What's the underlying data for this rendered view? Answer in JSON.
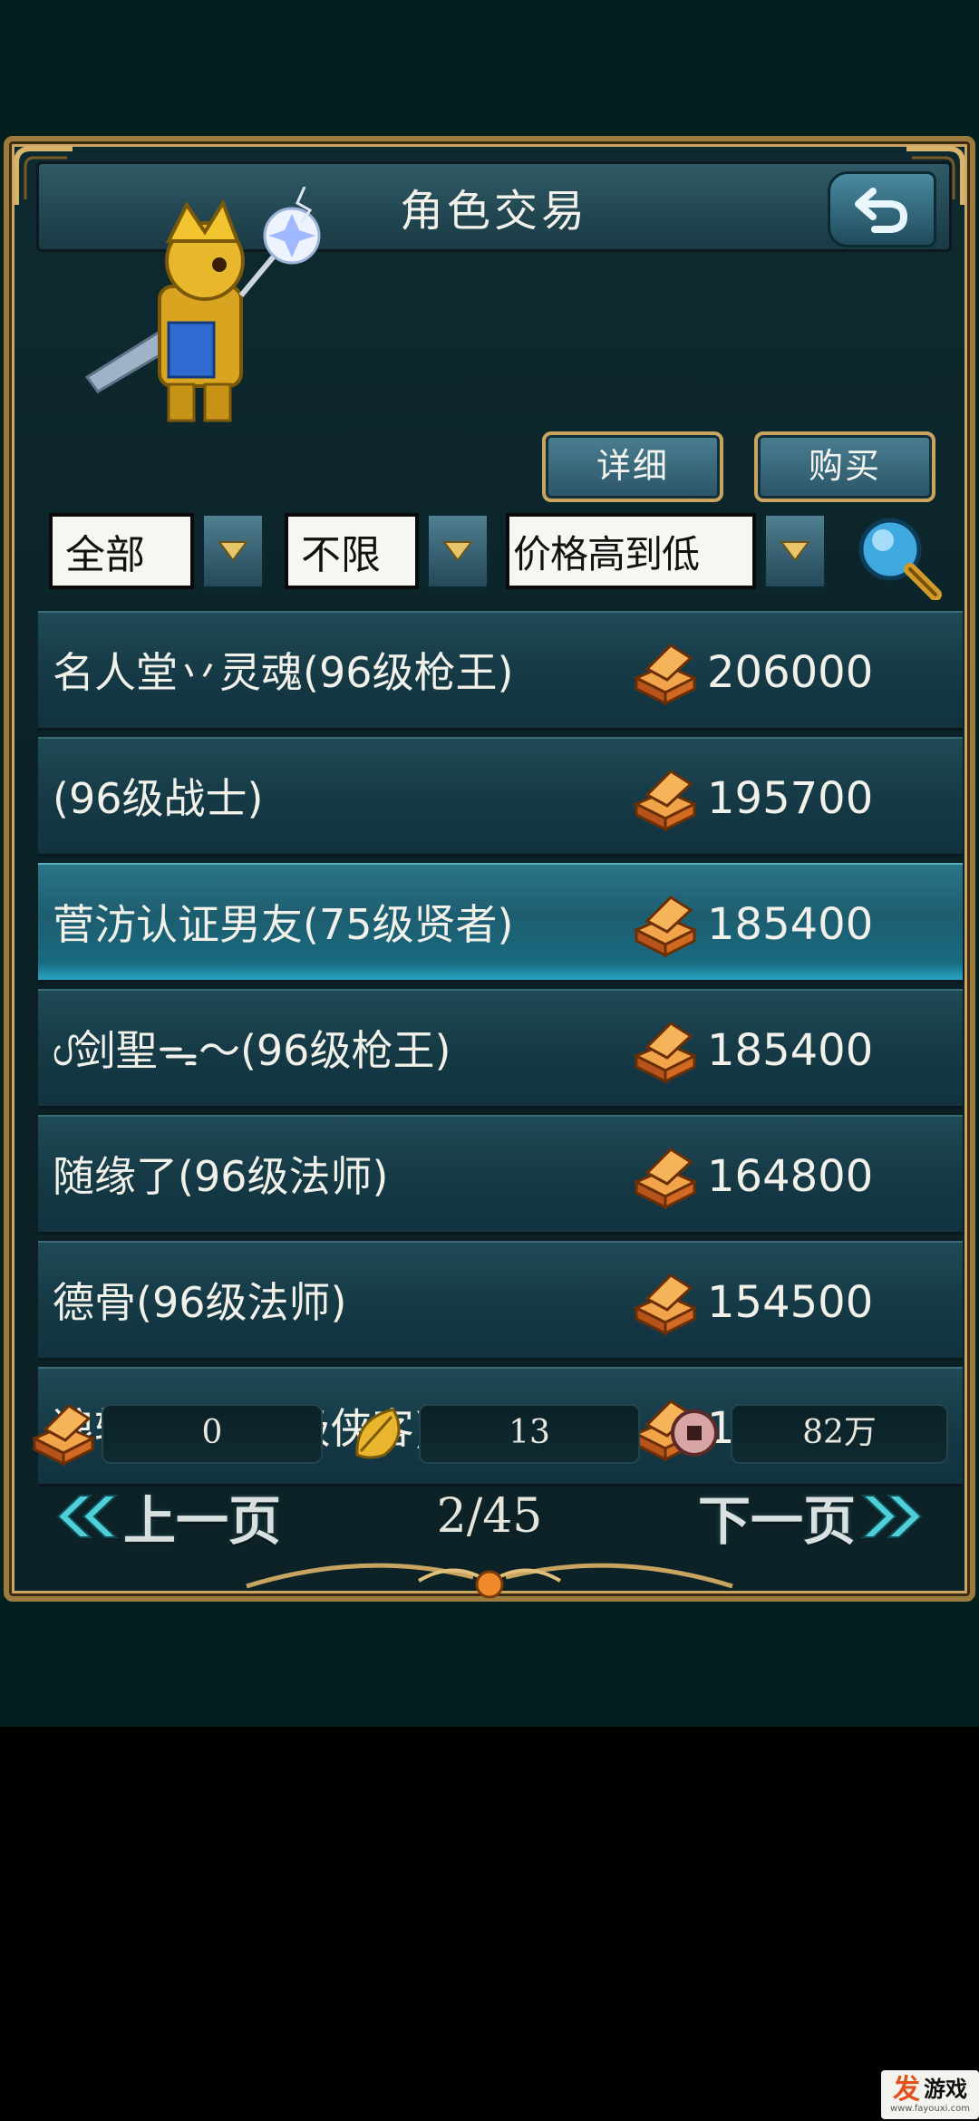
{
  "header": {
    "title": "角色交易"
  },
  "actions": {
    "detail_label": "详细",
    "buy_label": "购买"
  },
  "filters": {
    "category": "全部",
    "limit": "不限",
    "sort": "价格高到低"
  },
  "listings": [
    {
      "name": "名人堂丷灵魂(96级枪王)",
      "price": "206000",
      "selected": false
    },
    {
      "name": "(96级战士)",
      "price": "195700",
      "selected": false
    },
    {
      "name": "菅汸认证男友(75级贤者)",
      "price": "185400",
      "selected": true
    },
    {
      "name": "ᦔ剑聖ᯓ〜(96级枪王)",
      "price": "185400",
      "selected": false
    },
    {
      "name": "随缘了(96级法师)",
      "price": "164800",
      "selected": false
    },
    {
      "name": "德骨(96级法师)",
      "price": "154500",
      "selected": false
    },
    {
      "name": "狼轮刀破(96级侠客)",
      "price": "145827",
      "selected": false
    }
  ],
  "currencies": {
    "ingot": "0",
    "leaf": "13",
    "coin": "82万"
  },
  "pager": {
    "prev_label": "上一页",
    "next_label": "下一页",
    "indicator": "2/45"
  },
  "watermark": {
    "brand_a": "发",
    "brand_b": "游戏",
    "url": "www.fayouxi.com"
  },
  "colors": {
    "panel_border": "#9e7b3e",
    "row_bg": "#153945",
    "row_selected": "#1e5d70",
    "ingot": "#d2691e"
  }
}
